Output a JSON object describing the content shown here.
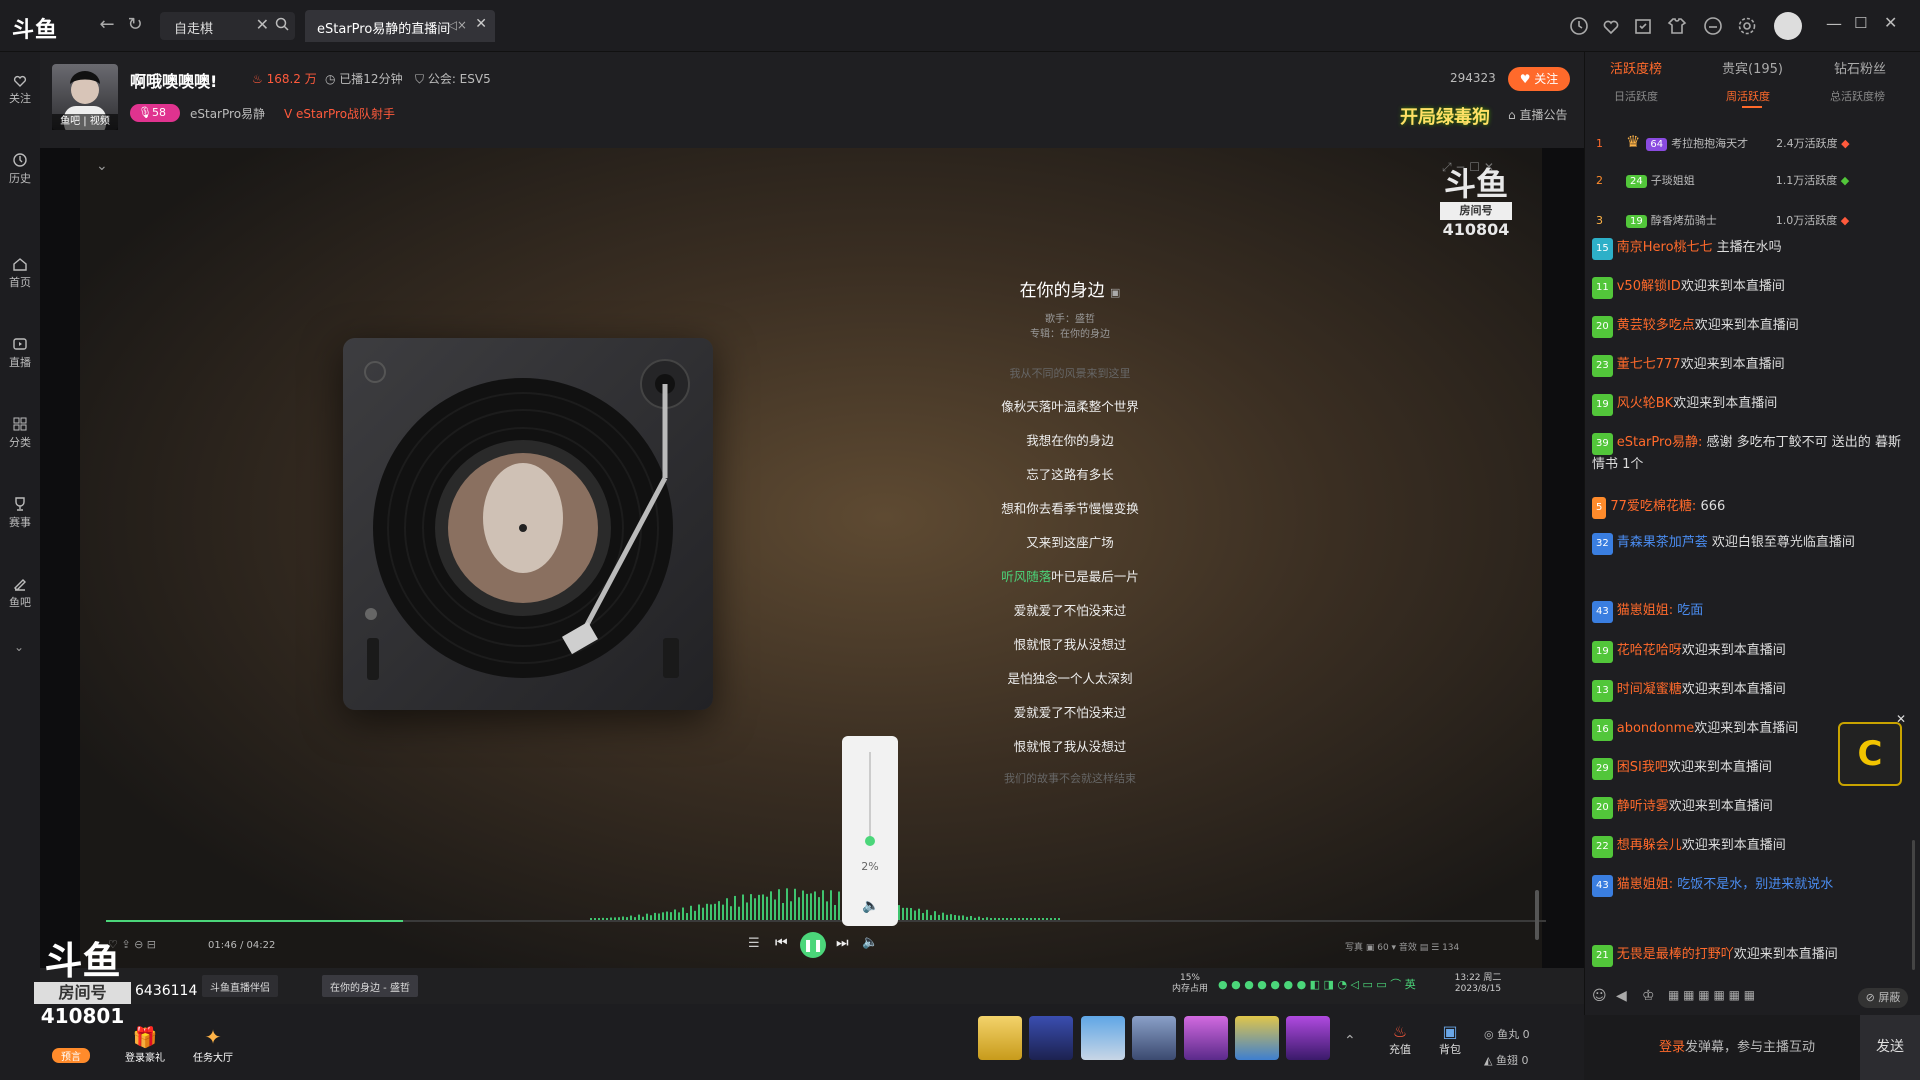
{
  "app": {
    "logo": "斗鱼"
  },
  "tabs": {
    "search_tab": "自走棋",
    "live_tab": "eStarPro易静的直播间"
  },
  "header": {
    "streamer_name": "啊哦噢噢噢!",
    "avatar_caption": "鱼吧 | 视频",
    "hot": "168.2 万",
    "duration": "已播12分钟",
    "guild": "公会: ESV5",
    "fan_badge": "58",
    "tag_user": "eStarPro易静",
    "tag_team": "eStarPro战队射手",
    "room_count": "294323",
    "follow": "关注",
    "banner": "开局绿毒狗",
    "announce": "直播公告"
  },
  "sidebar": {
    "items": [
      "关注",
      "历史",
      "首页",
      "直播",
      "分类",
      "赛事",
      "鱼吧"
    ]
  },
  "watermark": {
    "logo": "斗鱼",
    "room_label": "房间号",
    "room_number": "410804"
  },
  "player": {
    "song_title": "在你的身边",
    "singer": "歌手：盛哲",
    "album": "专辑：在你的身边",
    "lyrics": {
      "l0": "我从不同的风景来到这里",
      "l1": "像秋天落叶温柔整个世界",
      "l2": "我想在你的身边",
      "l3": "忘了这路有多长",
      "l4": "想和你去看季节慢慢变换",
      "l5": "又来到这座广场",
      "l6a": "听风随落",
      "l6b": "叶已是最后一片",
      "l7": "爱就爱了不怕没来过",
      "l8": "恨就恨了我从没想过",
      "l9": "是怕独念一个人太深刻",
      "l10": "爱就爱了不怕没来过",
      "l11": "恨就恨了我从没想过",
      "l12": "我们的故事不会就这样结束"
    },
    "volume": "2%",
    "volume_level": 0.02,
    "progress": 0.206,
    "time": "01:46 / 04:22",
    "right_controls": "写真 ▣  60 ▾  音效  ▤  ☰ 134"
  },
  "taskbar": {
    "item1": "斗鱼直播伴侣",
    "item2": "在你的身边 - 盛哲",
    "mem": "15%",
    "mem_label": "内存占用",
    "time": "13:22 周二",
    "date": "2023/8/15"
  },
  "bottom": {
    "logo": "斗鱼",
    "room_label": "房间号",
    "room_number": "410801",
    "viewers": "6436114",
    "preview": "预言",
    "login_gift": "登录豪礼",
    "task_hall": "任务大厅",
    "recharge": "充值",
    "backpack": "背包",
    "yuwan": "鱼丸  0",
    "yuchi": "鱼翅  0"
  },
  "right_panel": {
    "tabs": [
      "活跃度榜",
      "贵宾(195)",
      "钻石粉丝"
    ],
    "subtabs": [
      "日活跃度",
      "周活跃度",
      "总活跃度榜"
    ],
    "ranks": [
      {
        "rank": "1",
        "level": "64",
        "name": "考拉抱抱海天才",
        "score": "2.4万活跃度"
      },
      {
        "rank": "2",
        "level": "24",
        "name": "子琰姐姐",
        "score": "1.1万活跃度"
      },
      {
        "rank": "3",
        "level": "19",
        "name": "醇香烤茄骑士",
        "score": "1.0万活跃度"
      }
    ],
    "chat": [
      {
        "lvl": "15",
        "user": "南京Hero桃七七",
        "msg": "主播在水吗"
      },
      {
        "lvl": "11",
        "user": "v50解锁ID",
        "msg": "欢迎来到本直播间"
      },
      {
        "lvl": "20",
        "user": "黄芸较多吃点",
        "msg": "欢迎来到本直播间"
      },
      {
        "lvl": "23",
        "user": "董七七777",
        "msg": "欢迎来到本直播间"
      },
      {
        "lvl": "19",
        "user": "风火轮BK",
        "msg": "欢迎来到本直播间"
      },
      {
        "lvl": "39",
        "user": "eStarPro易静:",
        "msg": "感谢 多吃布丁鲛不可 送出的 暮斯情书 1个"
      },
      {
        "lvl": "5",
        "user": "77爱吃棉花糖:",
        "msg": "666"
      },
      {
        "lvl": "32",
        "user": "青森果茶加芦荟",
        "msg": "欢迎白银至尊光临直播间"
      },
      {
        "lvl": "43",
        "user": "猫崽姐姐:",
        "msg": "吃面"
      },
      {
        "lvl": "19",
        "user": "花哈花哈呀",
        "msg": "欢迎来到本直播间"
      },
      {
        "lvl": "13",
        "user": "时间凝蜜糖",
        "msg": "欢迎来到本直播间"
      },
      {
        "lvl": "16",
        "user": "abondonme",
        "msg": "欢迎来到本直播间"
      },
      {
        "lvl": "29",
        "user": "困SI我吧",
        "msg": "欢迎来到本直播间"
      },
      {
        "lvl": "20",
        "user": "静听诗雾",
        "msg": "欢迎来到本直播间"
      },
      {
        "lvl": "22",
        "user": "想再躲会儿",
        "msg": "欢迎来到本直播间"
      },
      {
        "lvl": "43",
        "user": "猫崽姐姐:",
        "msg": "吃饭不是水，别进来就说水"
      },
      {
        "lvl": "21",
        "user": "无畏是最棒的打野吖",
        "msg": "欢迎来到本直播间"
      }
    ],
    "block": "屏蔽",
    "input_login": "登录",
    "input_rest": "发弹幕，参与主播互动",
    "send": "发送"
  }
}
